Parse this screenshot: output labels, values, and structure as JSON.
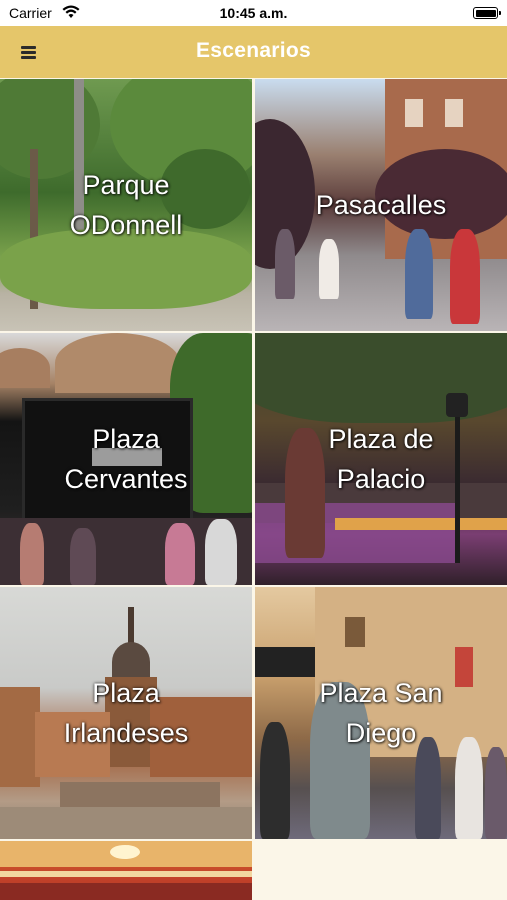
{
  "status_bar": {
    "carrier": "Carrier",
    "time": "10:45 a.m."
  },
  "nav": {
    "title": "Escenarios",
    "menu_icon": "hamburger-menu-icon"
  },
  "scenarios": [
    {
      "line1": "Parque",
      "line2": "ODonnell"
    },
    {
      "line1": "Pasacalles",
      "line2": ""
    },
    {
      "line1": "Plaza",
      "line2": "Cervantes"
    },
    {
      "line1": "Plaza de",
      "line2": "Palacio"
    },
    {
      "line1": "Plaza",
      "line2": "Irlandeses"
    },
    {
      "line1": "Plaza San",
      "line2": "Diego"
    },
    {
      "line1": "",
      "line2": ""
    }
  ],
  "colors": {
    "nav_background": "#e5c66a",
    "nav_title": "#ffffff",
    "page_background": "#fbf6e8"
  }
}
